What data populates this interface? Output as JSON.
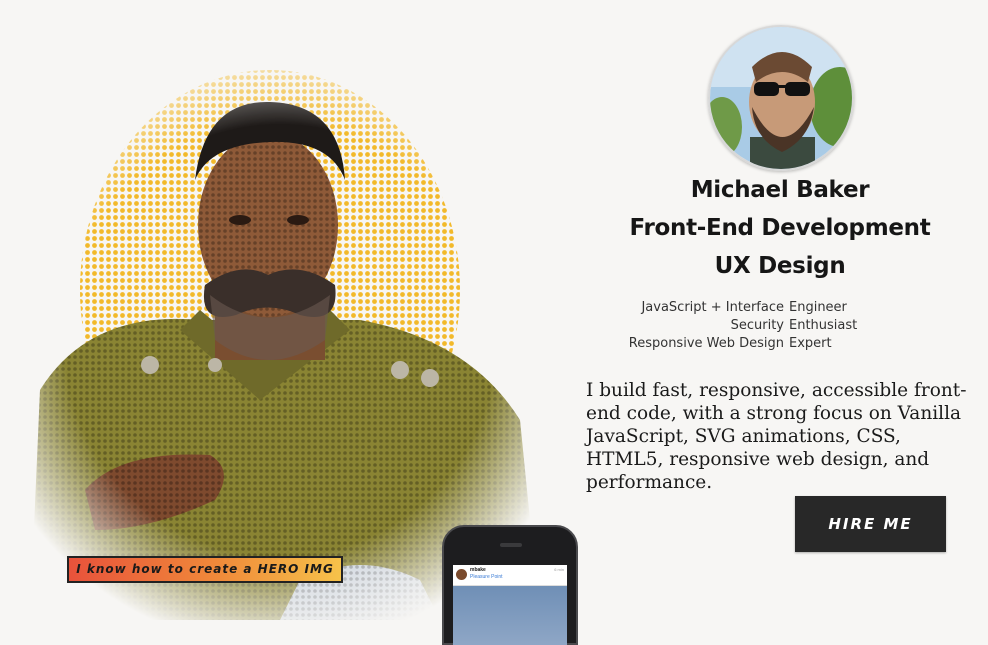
{
  "hero": {
    "caption": "I know how to create a HERO IMG"
  },
  "phone": {
    "username": "mbake",
    "location": "Pleasure Point",
    "time": "6 min"
  },
  "profile": {
    "name": "Michael Baker",
    "title_line_1": "Front-End Development",
    "title_line_2": "UX Design"
  },
  "roles": [
    {
      "left": "JavaScript + Interface",
      "right": "Engineer"
    },
    {
      "left": "Security",
      "right": "Enthusiast"
    },
    {
      "left": "Responsive Web Design",
      "right": "Expert"
    }
  ],
  "pitch": "I build fast, responsive, accessible front-end code, with a strong focus on Vanilla JavaScript, SVG animations, CSS, HTML5, responsive web design, and performance.",
  "cta": {
    "label": "HIRE ME"
  },
  "colors": {
    "background": "#f7f6f4",
    "button": "#282828",
    "caption_gradient_start": "#e8523b",
    "caption_gradient_end": "#f6c24a"
  }
}
